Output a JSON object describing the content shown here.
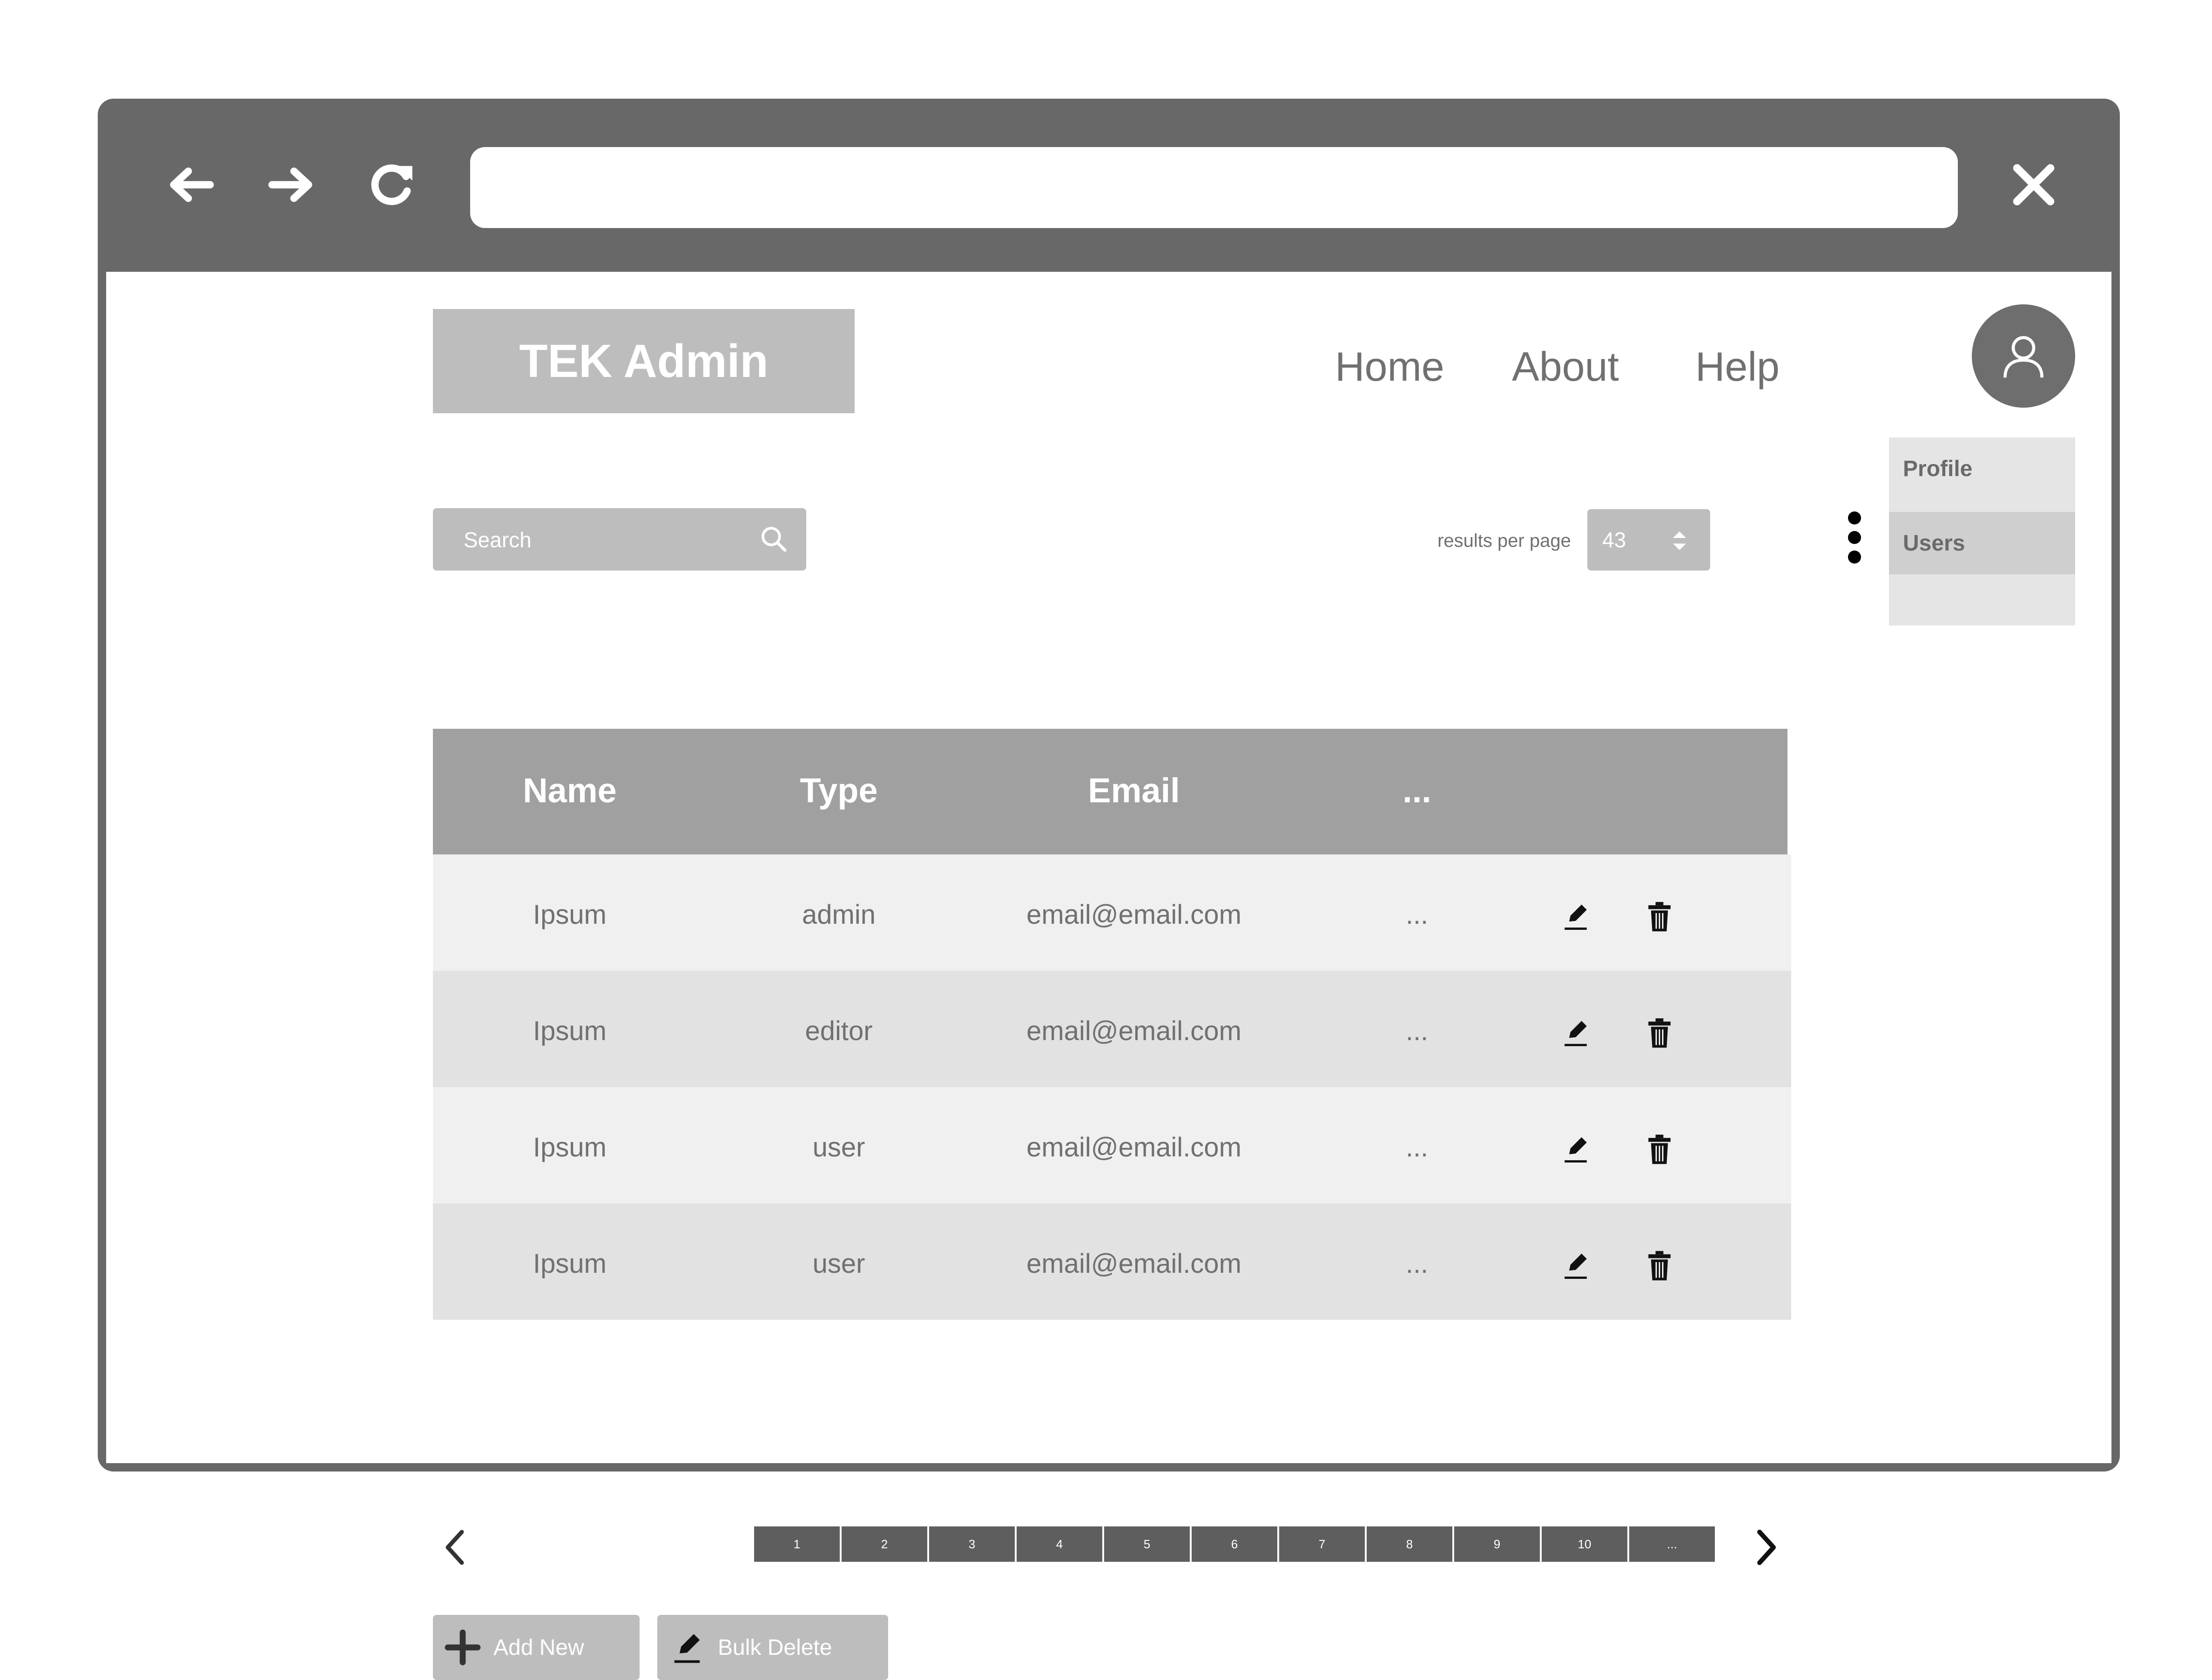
{
  "browser": {
    "address_value": "",
    "back_icon": "arrow-left-icon",
    "forward_icon": "arrow-right-icon",
    "reload_icon": "reload-icon",
    "close_icon": "close-icon"
  },
  "app": {
    "logo": "TEK Admin",
    "nav": {
      "home": "Home",
      "about": "About",
      "help": "Help"
    },
    "user_menu": {
      "profile": "Profile",
      "users": "Users",
      "selected": "Users"
    }
  },
  "toolbar": {
    "search_placeholder": "Search",
    "search_value": "",
    "results_per_page_label": "results per page",
    "results_per_page_value": "43"
  },
  "table": {
    "columns": [
      "Name",
      "Type",
      "Email",
      "..."
    ],
    "rows": [
      {
        "name": "Ipsum",
        "type": "admin",
        "email": "email@email.com",
        "more": "..."
      },
      {
        "name": "Ipsum",
        "type": "editor",
        "email": "email@email.com",
        "more": "..."
      },
      {
        "name": "Ipsum",
        "type": "user",
        "email": "email@email.com",
        "more": "..."
      },
      {
        "name": "Ipsum",
        "type": "user",
        "email": "email@email.com",
        "more": "..."
      }
    ],
    "row_actions": [
      "edit-icon",
      "trash-icon"
    ]
  },
  "pagination": {
    "pages": [
      "1",
      "2",
      "3",
      "4",
      "5",
      "6",
      "7",
      "8",
      "9",
      "10",
      "..."
    ]
  },
  "actions": {
    "add_new": "Add New",
    "bulk_delete": "Bulk Delete"
  },
  "colors": {
    "browser_frame": "#686868",
    "header_bg": "#a0a0a0",
    "control_bg": "#bdbdbd",
    "pager_bg": "#5e5e5e",
    "row_odd": "#f0f0f0",
    "row_even": "#e2e2e2"
  }
}
